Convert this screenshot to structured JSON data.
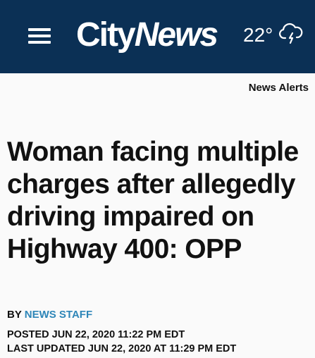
{
  "header": {
    "logo_city": "City",
    "logo_news": "News",
    "temperature": "22°",
    "weather_icon": "thunderstorm-cloud-icon",
    "background_color": "#0b3055"
  },
  "nav": {
    "alerts_label": "News Alerts"
  },
  "article": {
    "headline": "Woman facing multiple charges after allegedly driving impaired on Highway 400: OPP",
    "by_prefix": "BY",
    "author": "NEWS STAFF",
    "author_color": "#2e86b8",
    "posted": "POSTED JUN 22, 2020 11:22 PM EDT",
    "updated": "LAST UPDATED JUN 22, 2020 AT 11:29 PM EDT"
  }
}
